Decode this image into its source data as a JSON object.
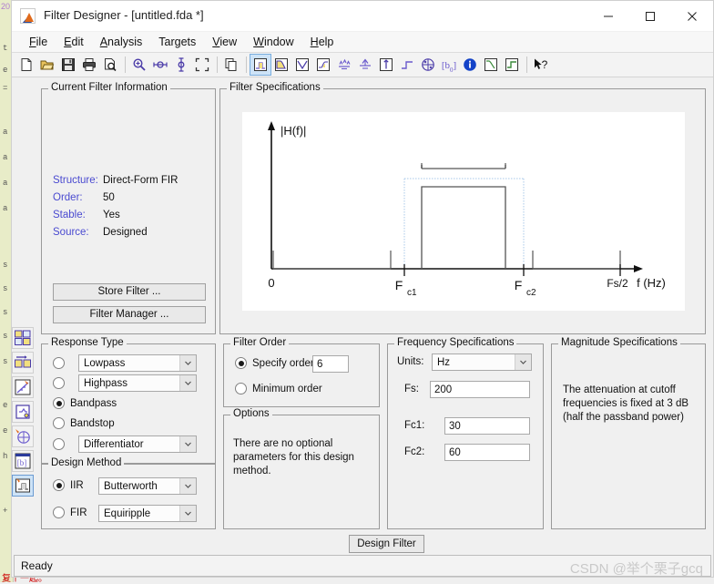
{
  "window": {
    "title": "Filter Designer -  [untitled.fda *]",
    "app_icon": "matlab-icon",
    "minimize": "–",
    "maximize": "□",
    "close": "✕"
  },
  "menubar": {
    "items": [
      {
        "label": "File",
        "key": "F"
      },
      {
        "label": "Edit",
        "key": "E"
      },
      {
        "label": "Analysis",
        "key": "A"
      },
      {
        "label": "Targets",
        "key": "g"
      },
      {
        "label": "View",
        "key": "V"
      },
      {
        "label": "Window",
        "key": "W"
      },
      {
        "label": "Help",
        "key": "H"
      }
    ]
  },
  "toolbar": {
    "buttons": [
      {
        "name": "new-file-icon",
        "title": "New"
      },
      {
        "name": "open-file-icon",
        "title": "Open"
      },
      {
        "name": "save-icon",
        "title": "Save"
      },
      {
        "name": "print-icon",
        "title": "Print"
      },
      {
        "name": "print-preview-icon",
        "title": "Print Preview"
      },
      {
        "sep": true
      },
      {
        "name": "zoom-in-icon",
        "title": "Zoom In"
      },
      {
        "name": "zoom-x-icon",
        "title": "Zoom X"
      },
      {
        "name": "zoom-y-icon",
        "title": "Zoom Y"
      },
      {
        "name": "full-view-icon",
        "title": "Restore Default View"
      },
      {
        "sep": true
      },
      {
        "name": "copy-icon",
        "title": "Copy"
      },
      {
        "sep": true
      },
      {
        "name": "filter-specifications-icon",
        "title": "Filter Specifications",
        "active": true
      },
      {
        "name": "magnitude-response-icon",
        "title": "Magnitude Response"
      },
      {
        "name": "phase-response-icon",
        "title": "Phase Response"
      },
      {
        "name": "magnitude-phase-icon",
        "title": "Magnitude and Phase Responses"
      },
      {
        "name": "group-delay-icon",
        "title": "Group Delay Response"
      },
      {
        "name": "phase-delay-icon",
        "title": "Phase Delay"
      },
      {
        "name": "impulse-response-icon",
        "title": "Impulse Response"
      },
      {
        "name": "step-response-icon",
        "title": "Step Response"
      },
      {
        "name": "pole-zero-icon",
        "title": "Pole/Zero Plot"
      },
      {
        "name": "filter-coefficients-icon",
        "title": "Filter Coefficients"
      },
      {
        "name": "filter-information-icon",
        "title": "Filter Information"
      },
      {
        "name": "magnitude-response-estimate-icon",
        "title": "Magnitude Response Estimate"
      },
      {
        "name": "round-off-noise-icon",
        "title": "Round-off Noise Power Spectrum"
      },
      {
        "sep": true
      },
      {
        "name": "whats-this-help-icon",
        "title": "What's This?"
      }
    ]
  },
  "sidebar": {
    "buttons": [
      {
        "name": "design-filter-side-icon",
        "title": "Design Filter"
      },
      {
        "name": "import-filter-side-icon",
        "title": "Import Filter"
      },
      {
        "name": "quantize-filter-side-icon",
        "title": "Set Quantization Parameters"
      },
      {
        "name": "realize-model-side-icon",
        "title": "Realize Model"
      },
      {
        "name": "pole-zero-editor-side-icon",
        "title": "Pole/Zero Editor"
      },
      {
        "name": "transform-filter-side-icon",
        "title": "Transform Filter"
      },
      {
        "name": "design-multirate-side-icon",
        "title": "Create a Multirate Filter",
        "active": true
      }
    ]
  },
  "current_filter_information": {
    "legend": "Current Filter Information",
    "rows": [
      {
        "key": "Structure:",
        "value": "Direct-Form FIR"
      },
      {
        "key": "Order:",
        "value": "50"
      },
      {
        "key": "Stable:",
        "value": "Yes"
      },
      {
        "key": "Source:",
        "value": "Designed"
      }
    ],
    "store_filter_label": "Store Filter ...",
    "filter_manager_label": "Filter Manager ..."
  },
  "filter_specifications": {
    "legend": "Filter Specifications",
    "y_axis_label": "|H(f)|",
    "x_axis_label": "f (Hz)",
    "ticks": [
      {
        "label": "0",
        "sub": ""
      },
      {
        "label": "F",
        "sub": "c1"
      },
      {
        "label": "F",
        "sub": "c2"
      },
      {
        "label": "Fs/2",
        "sub": ""
      }
    ]
  },
  "chart_data": {
    "type": "line",
    "title": "Filter Specifications",
    "xlabel": "f (Hz)",
    "ylabel": "|H(f)|",
    "response_type": "bandpass",
    "x_ticks": [
      "0",
      "Fc1",
      "Fc2",
      "Fs/2"
    ],
    "x_tick_positions": [
      0.0,
      0.383,
      0.724,
      0.955
    ],
    "bands": [
      {
        "name": "stopband-1",
        "x_start": 0.0,
        "x_end": 0.327,
        "level": 0.085,
        "style": "solid-bracket"
      },
      {
        "name": "transition-band-lower",
        "x_start": 0.327,
        "x_end": 0.383,
        "level": null,
        "style": "none"
      },
      {
        "name": "passband-ripple-upper",
        "x_start": 0.3,
        "x_end": 0.48,
        "level": 0.775,
        "style": "solid-bracket"
      },
      {
        "name": "passband",
        "x_start": 0.383,
        "x_end": 0.724,
        "level": 0.66,
        "style": "solid-box"
      },
      {
        "name": "passband-dotted-region",
        "x_start": 0.352,
        "x_end": 0.79,
        "level": 0.725,
        "style": "dotted-box"
      },
      {
        "name": "stopband-2",
        "x_start": 0.83,
        "x_end": 0.955,
        "level": 0.085,
        "style": "solid-bracket"
      }
    ],
    "grid": false,
    "legend": "none"
  },
  "response_type": {
    "legend": "Response Type",
    "options": [
      {
        "label": "Lowpass",
        "selected": false,
        "has_dropdown": true
      },
      {
        "label": "Highpass",
        "selected": false,
        "has_dropdown": true
      },
      {
        "label": "Bandpass",
        "selected": true,
        "has_dropdown": false
      },
      {
        "label": "Bandstop",
        "selected": false,
        "has_dropdown": false
      },
      {
        "label": "Differentiator",
        "selected": false,
        "has_dropdown": true
      }
    ]
  },
  "design_method": {
    "legend": "Design Method",
    "options": [
      {
        "label": "IIR",
        "selected": true,
        "value": "Butterworth"
      },
      {
        "label": "FIR",
        "selected": false,
        "value": "Equiripple"
      }
    ]
  },
  "filter_order": {
    "legend": "Filter Order",
    "specify_order_label": "Specify order:",
    "specify_order_selected": true,
    "order_value": "6",
    "minimum_order_label": "Minimum order",
    "minimum_order_selected": false
  },
  "options": {
    "legend": "Options",
    "message": "There are no optional parameters for this design method."
  },
  "frequency_specifications": {
    "legend": "Frequency Specifications",
    "units_label": "Units:",
    "units_value": "Hz",
    "fields": [
      {
        "label": "Fs:",
        "value": "200"
      },
      {
        "label": "Fc1:",
        "value": "30"
      },
      {
        "label": "Fc2:",
        "value": "60"
      }
    ]
  },
  "magnitude_specifications": {
    "legend": "Magnitude Specifications",
    "message": "The attenuation at cutoff frequencies is fixed at 3 dB (half the passband power)"
  },
  "design_filter_button": "Design Filter",
  "statusbar": {
    "status": "Ready",
    "watermark": "CSDN @举个栗子gcq"
  },
  "background_editor": {
    "line_number": "20",
    "fragments": [
      "t",
      "e",
      "=",
      "a",
      "a",
      "a",
      "a",
      "s",
      "s"
    ],
    "bottom_note": "复个一起。"
  }
}
